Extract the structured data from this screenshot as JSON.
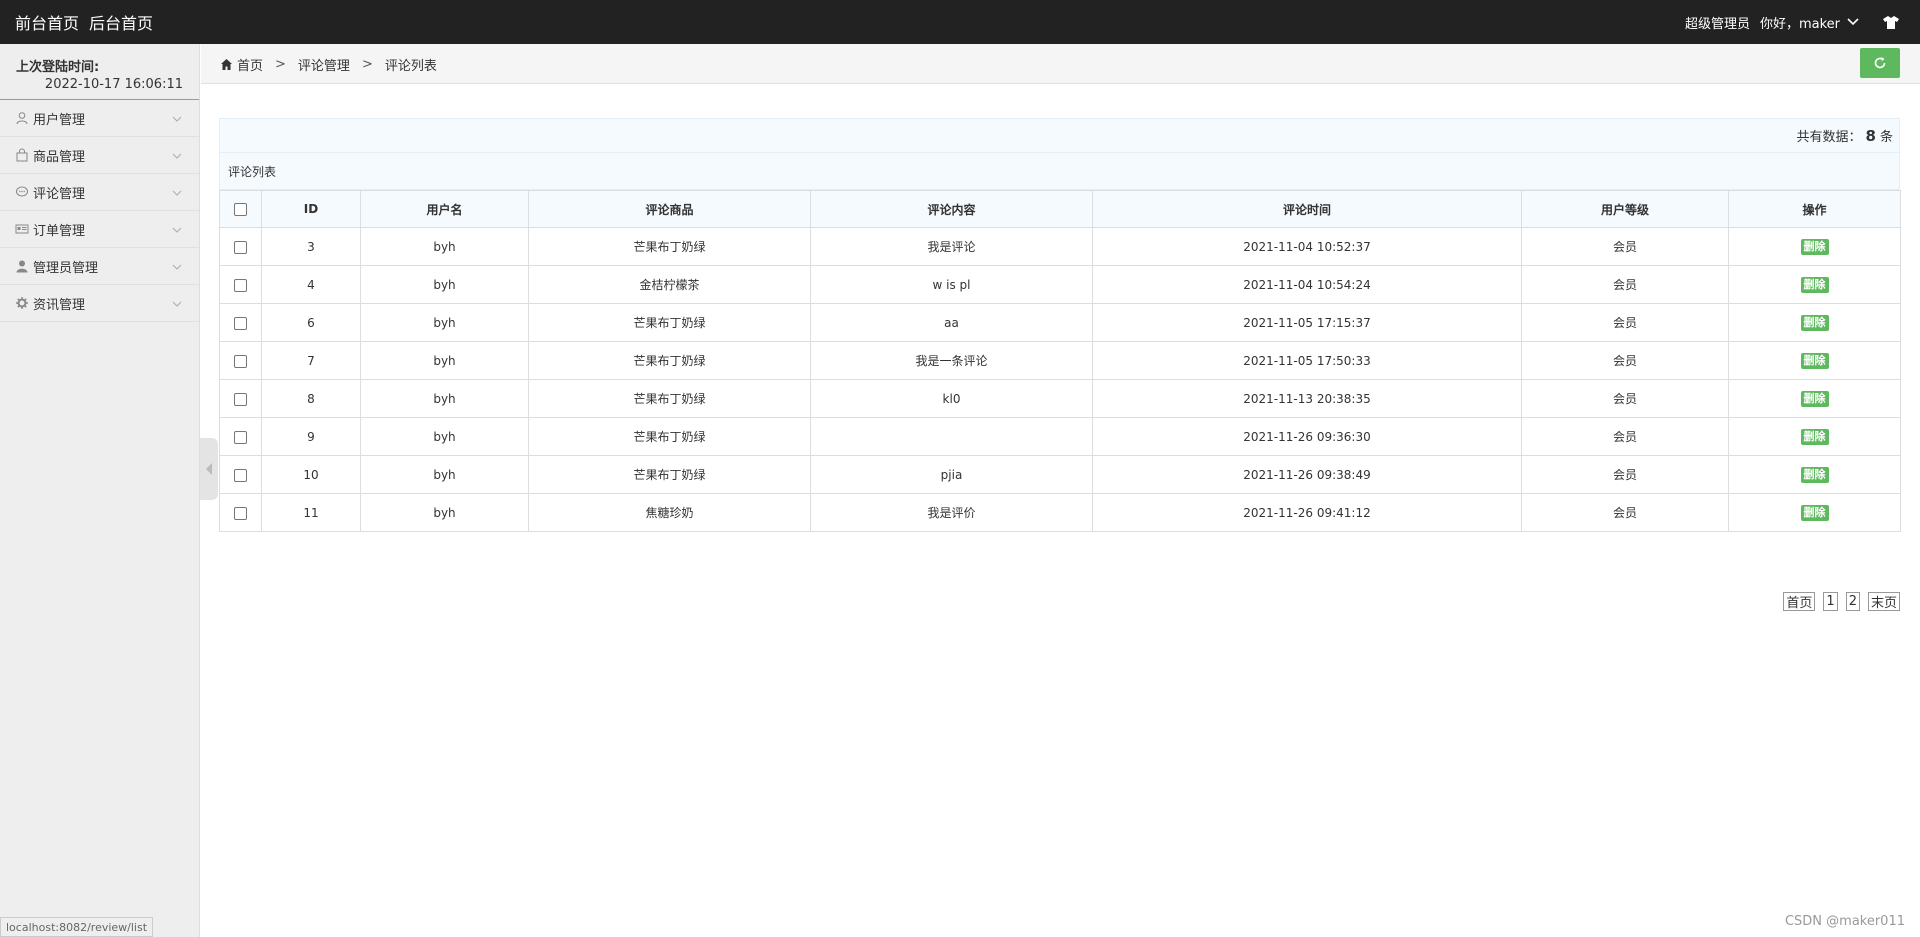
{
  "topbar": {
    "front_home": "前台首页",
    "back_home": "后台首页",
    "role": "超级管理员",
    "greeting": "你好，maker"
  },
  "sidebar": {
    "last_login_label": "上次登陆时间:",
    "last_login_time": "2022-10-17 16:06:11",
    "items": [
      {
        "label": "用户管理",
        "icon": "user-icon"
      },
      {
        "label": "商品管理",
        "icon": "bag-icon"
      },
      {
        "label": "评论管理",
        "icon": "comment-icon"
      },
      {
        "label": "订单管理",
        "icon": "order-card-icon"
      },
      {
        "label": "管理员管理",
        "icon": "admin-icon"
      },
      {
        "label": "资讯管理",
        "icon": "gear-icon"
      }
    ]
  },
  "breadcrumb": {
    "home": "首页",
    "level1": "评论管理",
    "level2": "评论列表",
    "sep": ">"
  },
  "summary": {
    "prefix": "共有数据：",
    "count": "8",
    "suffix": "条"
  },
  "list_title": "评论列表",
  "table": {
    "headers": [
      "ID",
      "用户名",
      "评论商品",
      "评论内容",
      "评论时间",
      "用户等级",
      "操作"
    ],
    "delete_label": "删除",
    "rows": [
      {
        "id": "3",
        "user": "byh",
        "product": "芒果布丁奶绿",
        "content": "我是评论",
        "time": "2021-11-04 10:52:37",
        "level": "会员"
      },
      {
        "id": "4",
        "user": "byh",
        "product": "金桔柠檬茶",
        "content": "w is pl",
        "time": "2021-11-04 10:54:24",
        "level": "会员"
      },
      {
        "id": "6",
        "user": "byh",
        "product": "芒果布丁奶绿",
        "content": "aa",
        "time": "2021-11-05 17:15:37",
        "level": "会员"
      },
      {
        "id": "7",
        "user": "byh",
        "product": "芒果布丁奶绿",
        "content": "我是一条评论",
        "time": "2021-11-05 17:50:33",
        "level": "会员"
      },
      {
        "id": "8",
        "user": "byh",
        "product": "芒果布丁奶绿",
        "content": "kl0",
        "time": "2021-11-13 20:38:35",
        "level": "会员"
      },
      {
        "id": "9",
        "user": "byh",
        "product": "芒果布丁奶绿",
        "content": "",
        "time": "2021-11-26 09:36:30",
        "level": "会员"
      },
      {
        "id": "10",
        "user": "byh",
        "product": "芒果布丁奶绿",
        "content": "pjia",
        "time": "2021-11-26 09:38:49",
        "level": "会员"
      },
      {
        "id": "11",
        "user": "byh",
        "product": "焦糖珍奶",
        "content": "我是评价",
        "time": "2021-11-26 09:41:12",
        "level": "会员"
      }
    ]
  },
  "pager": {
    "first": "首页",
    "pages": [
      "1",
      "2"
    ],
    "last": "末页"
  },
  "status_url": "localhost:8082/review/list",
  "watermark": "CSDN @maker011",
  "colors": {
    "topbar": "#222222",
    "accent_green": "#5eb95e",
    "sidebar_bg": "#eeeeee"
  }
}
